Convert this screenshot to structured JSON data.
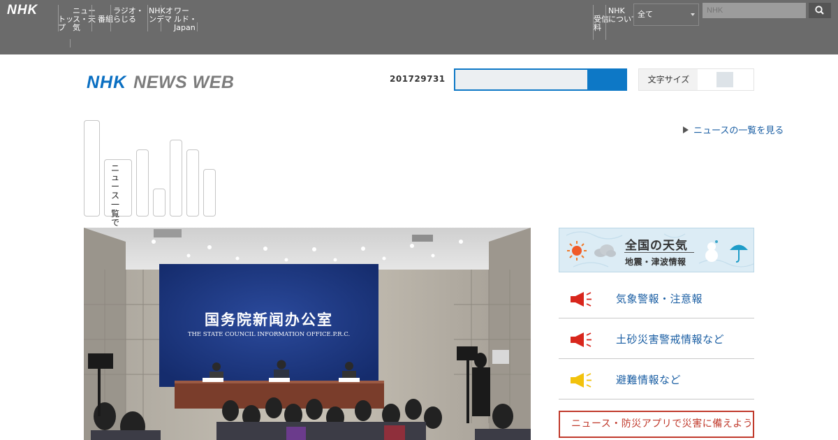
{
  "top_bar": {
    "logo": "NHK",
    "nav_items": [
      "トッ\nプ",
      "ニュー\nス・天\n気",
      "番組",
      "ラジオ・\nらじる",
      "NHKオ\nンデマ",
      "ワー\nルド・\nJapan"
    ],
    "right_nav_items": [
      "受信\n料",
      "NHK\nについて"
    ],
    "select_value": "全て",
    "search_placeholder": "NHK"
  },
  "header": {
    "logo_nhk": "NHK",
    "logo_news_web": "NEWS WEB",
    "date_code": "201729731",
    "toggle_label": "文字サイズ"
  },
  "tabs": [
    {
      "text": ""
    },
    {
      "text": "ニュース一覧で見る"
    },
    {
      "text": ""
    },
    {
      "text": ""
    },
    {
      "text": ""
    },
    {
      "text": ""
    },
    {
      "text": ""
    }
  ],
  "more_link": "ニュースの一覧を見る",
  "weather": {
    "title": "全国の天気",
    "subtitle": "地震・津波情報"
  },
  "alerts": [
    {
      "label": "気象警報・注意報",
      "color": "#d8261c"
    },
    {
      "label": "土砂災害警戒情報など",
      "color": "#d8261c"
    },
    {
      "label": "避難情報など",
      "color": "#f2c20c"
    }
  ],
  "red_box_text": "ニュース・防災アプリで災害に備えよう"
}
